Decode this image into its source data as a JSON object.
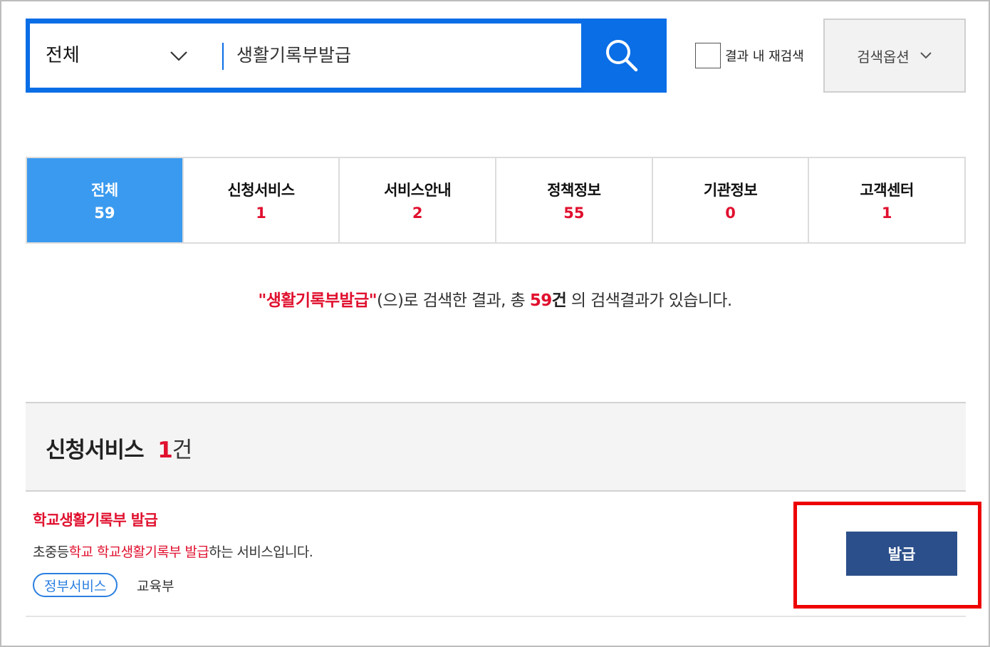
{
  "search": {
    "scope_label": "전체",
    "query": "생활기록부발급",
    "refine_label": "결과 내 재검색",
    "options_label": "검색옵션"
  },
  "tabs": [
    {
      "label": "전체",
      "count": "59"
    },
    {
      "label": "신청서비스",
      "count": "1"
    },
    {
      "label": "서비스안내",
      "count": "2"
    },
    {
      "label": "정책정보",
      "count": "55"
    },
    {
      "label": "기관정보",
      "count": "0"
    },
    {
      "label": "고객센터",
      "count": "1"
    }
  ],
  "summary": {
    "query_quoted": "\"생활기록부발급\"",
    "text1": "(으)로 검색한 결과, 총 ",
    "total": "59",
    "unit": "건",
    "text2": " 의 검색결과가 있습니다."
  },
  "section": {
    "title": "신청서비스",
    "count": "1",
    "unit": "건"
  },
  "result": {
    "title": "학교생활기록부 발급",
    "desc_prefix": "초중등",
    "desc_hl1": "학교",
    "desc_space": " ",
    "desc_hl2": "학교생활기록부 발급",
    "desc_suffix": "하는 서비스입니다.",
    "tag": "정부서비스",
    "agency": "교육부",
    "action_label": "발급"
  },
  "colors": {
    "primary_blue": "#0a6ee6",
    "active_tab": "#3a9aef",
    "accent_red": "#e0102e",
    "action_navy": "#2b4f8a",
    "highlight_box": "#ee0000"
  }
}
